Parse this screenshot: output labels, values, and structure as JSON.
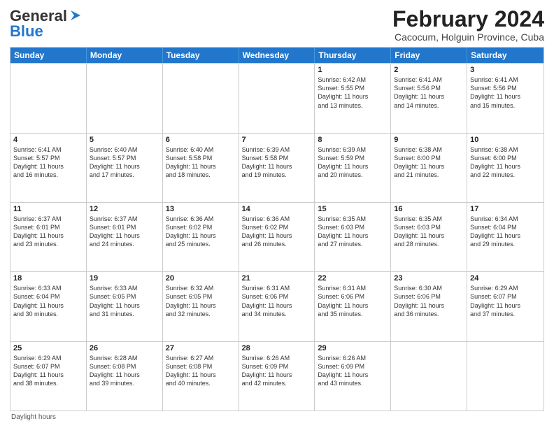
{
  "header": {
    "logo_line1": "General",
    "logo_line2": "Blue",
    "title": "February 2024",
    "subtitle": "Cacocum, Holguin Province, Cuba"
  },
  "weekdays": [
    "Sunday",
    "Monday",
    "Tuesday",
    "Wednesday",
    "Thursday",
    "Friday",
    "Saturday"
  ],
  "footer": "Daylight hours",
  "weeks": [
    [
      {
        "day": "",
        "info": ""
      },
      {
        "day": "",
        "info": ""
      },
      {
        "day": "",
        "info": ""
      },
      {
        "day": "",
        "info": ""
      },
      {
        "day": "1",
        "info": "Sunrise: 6:42 AM\nSunset: 5:55 PM\nDaylight: 11 hours\nand 13 minutes."
      },
      {
        "day": "2",
        "info": "Sunrise: 6:41 AM\nSunset: 5:56 PM\nDaylight: 11 hours\nand 14 minutes."
      },
      {
        "day": "3",
        "info": "Sunrise: 6:41 AM\nSunset: 5:56 PM\nDaylight: 11 hours\nand 15 minutes."
      }
    ],
    [
      {
        "day": "4",
        "info": "Sunrise: 6:41 AM\nSunset: 5:57 PM\nDaylight: 11 hours\nand 16 minutes."
      },
      {
        "day": "5",
        "info": "Sunrise: 6:40 AM\nSunset: 5:57 PM\nDaylight: 11 hours\nand 17 minutes."
      },
      {
        "day": "6",
        "info": "Sunrise: 6:40 AM\nSunset: 5:58 PM\nDaylight: 11 hours\nand 18 minutes."
      },
      {
        "day": "7",
        "info": "Sunrise: 6:39 AM\nSunset: 5:58 PM\nDaylight: 11 hours\nand 19 minutes."
      },
      {
        "day": "8",
        "info": "Sunrise: 6:39 AM\nSunset: 5:59 PM\nDaylight: 11 hours\nand 20 minutes."
      },
      {
        "day": "9",
        "info": "Sunrise: 6:38 AM\nSunset: 6:00 PM\nDaylight: 11 hours\nand 21 minutes."
      },
      {
        "day": "10",
        "info": "Sunrise: 6:38 AM\nSunset: 6:00 PM\nDaylight: 11 hours\nand 22 minutes."
      }
    ],
    [
      {
        "day": "11",
        "info": "Sunrise: 6:37 AM\nSunset: 6:01 PM\nDaylight: 11 hours\nand 23 minutes."
      },
      {
        "day": "12",
        "info": "Sunrise: 6:37 AM\nSunset: 6:01 PM\nDaylight: 11 hours\nand 24 minutes."
      },
      {
        "day": "13",
        "info": "Sunrise: 6:36 AM\nSunset: 6:02 PM\nDaylight: 11 hours\nand 25 minutes."
      },
      {
        "day": "14",
        "info": "Sunrise: 6:36 AM\nSunset: 6:02 PM\nDaylight: 11 hours\nand 26 minutes."
      },
      {
        "day": "15",
        "info": "Sunrise: 6:35 AM\nSunset: 6:03 PM\nDaylight: 11 hours\nand 27 minutes."
      },
      {
        "day": "16",
        "info": "Sunrise: 6:35 AM\nSunset: 6:03 PM\nDaylight: 11 hours\nand 28 minutes."
      },
      {
        "day": "17",
        "info": "Sunrise: 6:34 AM\nSunset: 6:04 PM\nDaylight: 11 hours\nand 29 minutes."
      }
    ],
    [
      {
        "day": "18",
        "info": "Sunrise: 6:33 AM\nSunset: 6:04 PM\nDaylight: 11 hours\nand 30 minutes."
      },
      {
        "day": "19",
        "info": "Sunrise: 6:33 AM\nSunset: 6:05 PM\nDaylight: 11 hours\nand 31 minutes."
      },
      {
        "day": "20",
        "info": "Sunrise: 6:32 AM\nSunset: 6:05 PM\nDaylight: 11 hours\nand 32 minutes."
      },
      {
        "day": "21",
        "info": "Sunrise: 6:31 AM\nSunset: 6:06 PM\nDaylight: 11 hours\nand 34 minutes."
      },
      {
        "day": "22",
        "info": "Sunrise: 6:31 AM\nSunset: 6:06 PM\nDaylight: 11 hours\nand 35 minutes."
      },
      {
        "day": "23",
        "info": "Sunrise: 6:30 AM\nSunset: 6:06 PM\nDaylight: 11 hours\nand 36 minutes."
      },
      {
        "day": "24",
        "info": "Sunrise: 6:29 AM\nSunset: 6:07 PM\nDaylight: 11 hours\nand 37 minutes."
      }
    ],
    [
      {
        "day": "25",
        "info": "Sunrise: 6:29 AM\nSunset: 6:07 PM\nDaylight: 11 hours\nand 38 minutes."
      },
      {
        "day": "26",
        "info": "Sunrise: 6:28 AM\nSunset: 6:08 PM\nDaylight: 11 hours\nand 39 minutes."
      },
      {
        "day": "27",
        "info": "Sunrise: 6:27 AM\nSunset: 6:08 PM\nDaylight: 11 hours\nand 40 minutes."
      },
      {
        "day": "28",
        "info": "Sunrise: 6:26 AM\nSunset: 6:09 PM\nDaylight: 11 hours\nand 42 minutes."
      },
      {
        "day": "29",
        "info": "Sunrise: 6:26 AM\nSunset: 6:09 PM\nDaylight: 11 hours\nand 43 minutes."
      },
      {
        "day": "",
        "info": ""
      },
      {
        "day": "",
        "info": ""
      }
    ]
  ]
}
